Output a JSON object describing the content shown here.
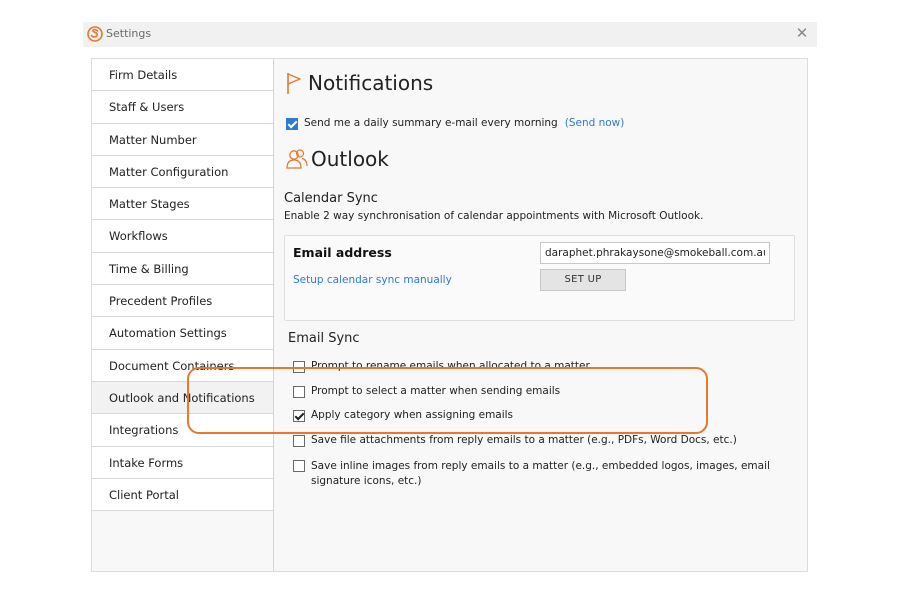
{
  "window": {
    "title": "Settings"
  },
  "sidebar": {
    "items": [
      {
        "label": "Firm Details"
      },
      {
        "label": "Staff & Users"
      },
      {
        "label": "Matter Number"
      },
      {
        "label": "Matter Configuration"
      },
      {
        "label": "Matter Stages"
      },
      {
        "label": "Workflows"
      },
      {
        "label": "Time & Billing"
      },
      {
        "label": "Precedent Profiles"
      },
      {
        "label": "Automation Settings"
      },
      {
        "label": "Document Containers"
      },
      {
        "label": "Outlook and Notifications",
        "active": true
      },
      {
        "label": "Integrations"
      },
      {
        "label": "Intake Forms"
      },
      {
        "label": "Client Portal"
      }
    ]
  },
  "notifications": {
    "title": "Notifications",
    "icon": "flag-icon",
    "daily_summary": {
      "label": "Send me a daily summary e-mail every morning",
      "checked": true,
      "link": "(Send now)"
    }
  },
  "outlook": {
    "title": "Outlook",
    "icon": "users-icon",
    "calendar_sync": {
      "title": "Calendar Sync",
      "description": "Enable 2 way synchronisation of calendar appointments with Microsoft Outlook.",
      "email_label": "Email address",
      "email_value": "daraphet.phrakaysone@smokeball.com.au",
      "setup_link": "Setup calendar sync manually",
      "setup_button": "SET UP"
    },
    "email_sync": {
      "title": "Email Sync",
      "options": [
        {
          "label": "Prompt to rename emails when allocated to a matter",
          "checked": false
        },
        {
          "label": "Prompt to select a matter when sending emails",
          "checked": false
        },
        {
          "label": "Apply category when assigning emails",
          "checked": true
        },
        {
          "label": "Save file attachments from reply emails to a matter (e.g., PDFs, Word Docs, etc.)",
          "checked": false
        },
        {
          "label": "Save inline images from reply emails to a matter (e.g., embedded logos, images, email signature icons, etc.)",
          "checked": false
        }
      ]
    }
  },
  "colors": {
    "accent": "#e8782c",
    "link": "#2f7ad0"
  }
}
